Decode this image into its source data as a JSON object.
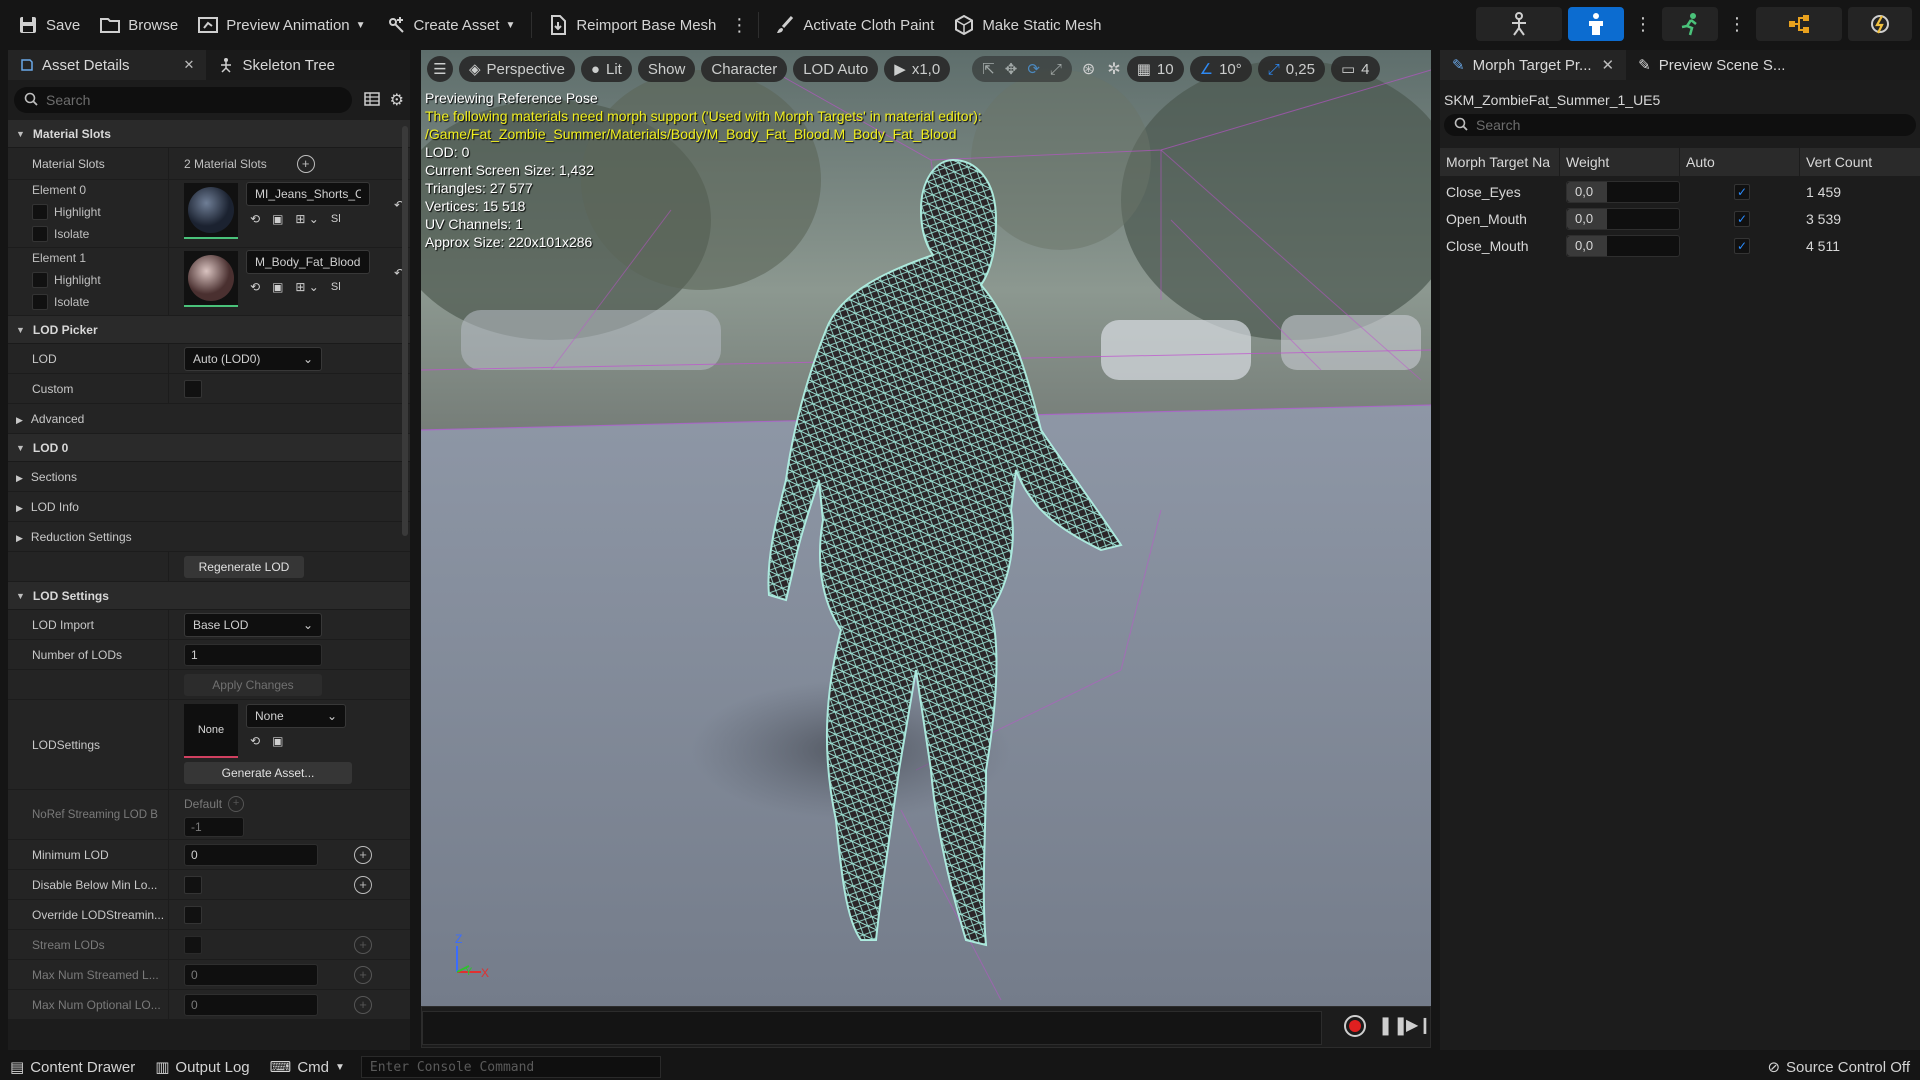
{
  "toolbar": {
    "save": "Save",
    "browse": "Browse",
    "preview_animation": "Preview Animation",
    "create_asset": "Create Asset",
    "reimport_base_mesh": "Reimport Base Mesh",
    "activate_cloth_paint": "Activate Cloth Paint",
    "make_static_mesh": "Make Static Mesh"
  },
  "left_panel": {
    "tabs": [
      "Asset Details",
      "Skeleton Tree"
    ],
    "search_placeholder": "Search",
    "material_slots": {
      "header": "Material Slots",
      "label": "Material Slots",
      "value": "2 Material Slots",
      "elements": [
        {
          "name": "Element 0",
          "material": "MI_Jeans_Shorts_Cus",
          "highlight": "Highlight",
          "isolate": "Isolate"
        },
        {
          "name": "Element 1",
          "material": "M_Body_Fat_Blood",
          "highlight": "Highlight",
          "isolate": "Isolate"
        }
      ]
    },
    "lod_picker": {
      "header": "LOD Picker",
      "lod_label": "LOD",
      "lod_value": "Auto (LOD0)",
      "custom_label": "Custom",
      "advanced_label": "Advanced"
    },
    "lod0": {
      "header": "LOD 0",
      "sections": "Sections",
      "lod_info": "LOD Info",
      "reduction": "Reduction Settings",
      "regenerate": "Regenerate LOD"
    },
    "lod_settings": {
      "header": "LOD Settings",
      "lod_import_label": "LOD Import",
      "lod_import_value": "Base LOD",
      "num_lods_label": "Number of LODs",
      "num_lods_value": "1",
      "apply": "Apply Changes",
      "lodsettings_label": "LODSettings",
      "lodsettings_thumb": "None",
      "lodsettings_value": "None",
      "generate_asset": "Generate Asset...",
      "noref_label": "NoRef Streaming LOD B",
      "noref_default": "Default",
      "noref_value": "-1",
      "min_lod_label": "Minimum LOD",
      "min_lod_value": "0",
      "disable_below_label": "Disable Below Min Lo...",
      "override_label": "Override LODStreamin...",
      "stream_lods_label": "Stream LODs",
      "max_streamed_label": "Max Num Streamed L...",
      "max_streamed_value": "0",
      "max_optional_label": "Max Num Optional LO...",
      "max_optional_value": "0"
    }
  },
  "viewport": {
    "menu_icon": "hamburger-icon",
    "perspective": "Perspective",
    "lit": "Lit",
    "show": "Show",
    "character": "Character",
    "lod_auto": "LOD Auto",
    "play_speed": "x1,0",
    "grid_size": "10",
    "rot_snap": "10°",
    "scale_snap": "0,25",
    "cam_speed": "4",
    "info": {
      "line1": "Previewing Reference Pose",
      "warn1": "The following materials need morph support ('Used with Morph Targets' in material editor):",
      "warn2": "/Game/Fat_Zombie_Summer/Materials/Body/M_Body_Fat_Blood.M_Body_Fat_Blood",
      "lod": "LOD: 0",
      "screen_size": "Current Screen Size: 1,432",
      "triangles": "Triangles: 27 577",
      "vertices": "Vertices: 15 518",
      "uv": "UV Channels: 1",
      "approx": "Approx Size: 220x101x286"
    },
    "axis": {
      "z": "Z",
      "y": "Y",
      "x": "X"
    }
  },
  "right_panel": {
    "tabs": [
      "Morph Target Pr...",
      "Preview Scene S..."
    ],
    "mesh_name": "SKM_ZombieFat_Summer_1_UE5",
    "search_placeholder": "Search",
    "columns": [
      "Morph Target Na",
      "Weight",
      "Auto",
      "Vert Count"
    ],
    "rows": [
      {
        "name": "Close_Eyes",
        "weight": "0,0",
        "verts": "1 459"
      },
      {
        "name": "Open_Mouth",
        "weight": "0,0",
        "verts": "3 539"
      },
      {
        "name": "Close_Mouth",
        "weight": "0,0",
        "verts": "4 511"
      }
    ]
  },
  "status_bar": {
    "content_drawer": "Content Drawer",
    "output_log": "Output Log",
    "cmd": "Cmd",
    "console_placeholder": "Enter Console Command",
    "source_control": "Source Control Off"
  },
  "colors": {
    "accent": "#0c6cd0",
    "warning": "#f1ef1f",
    "wireframe": "#9ff2e4"
  }
}
